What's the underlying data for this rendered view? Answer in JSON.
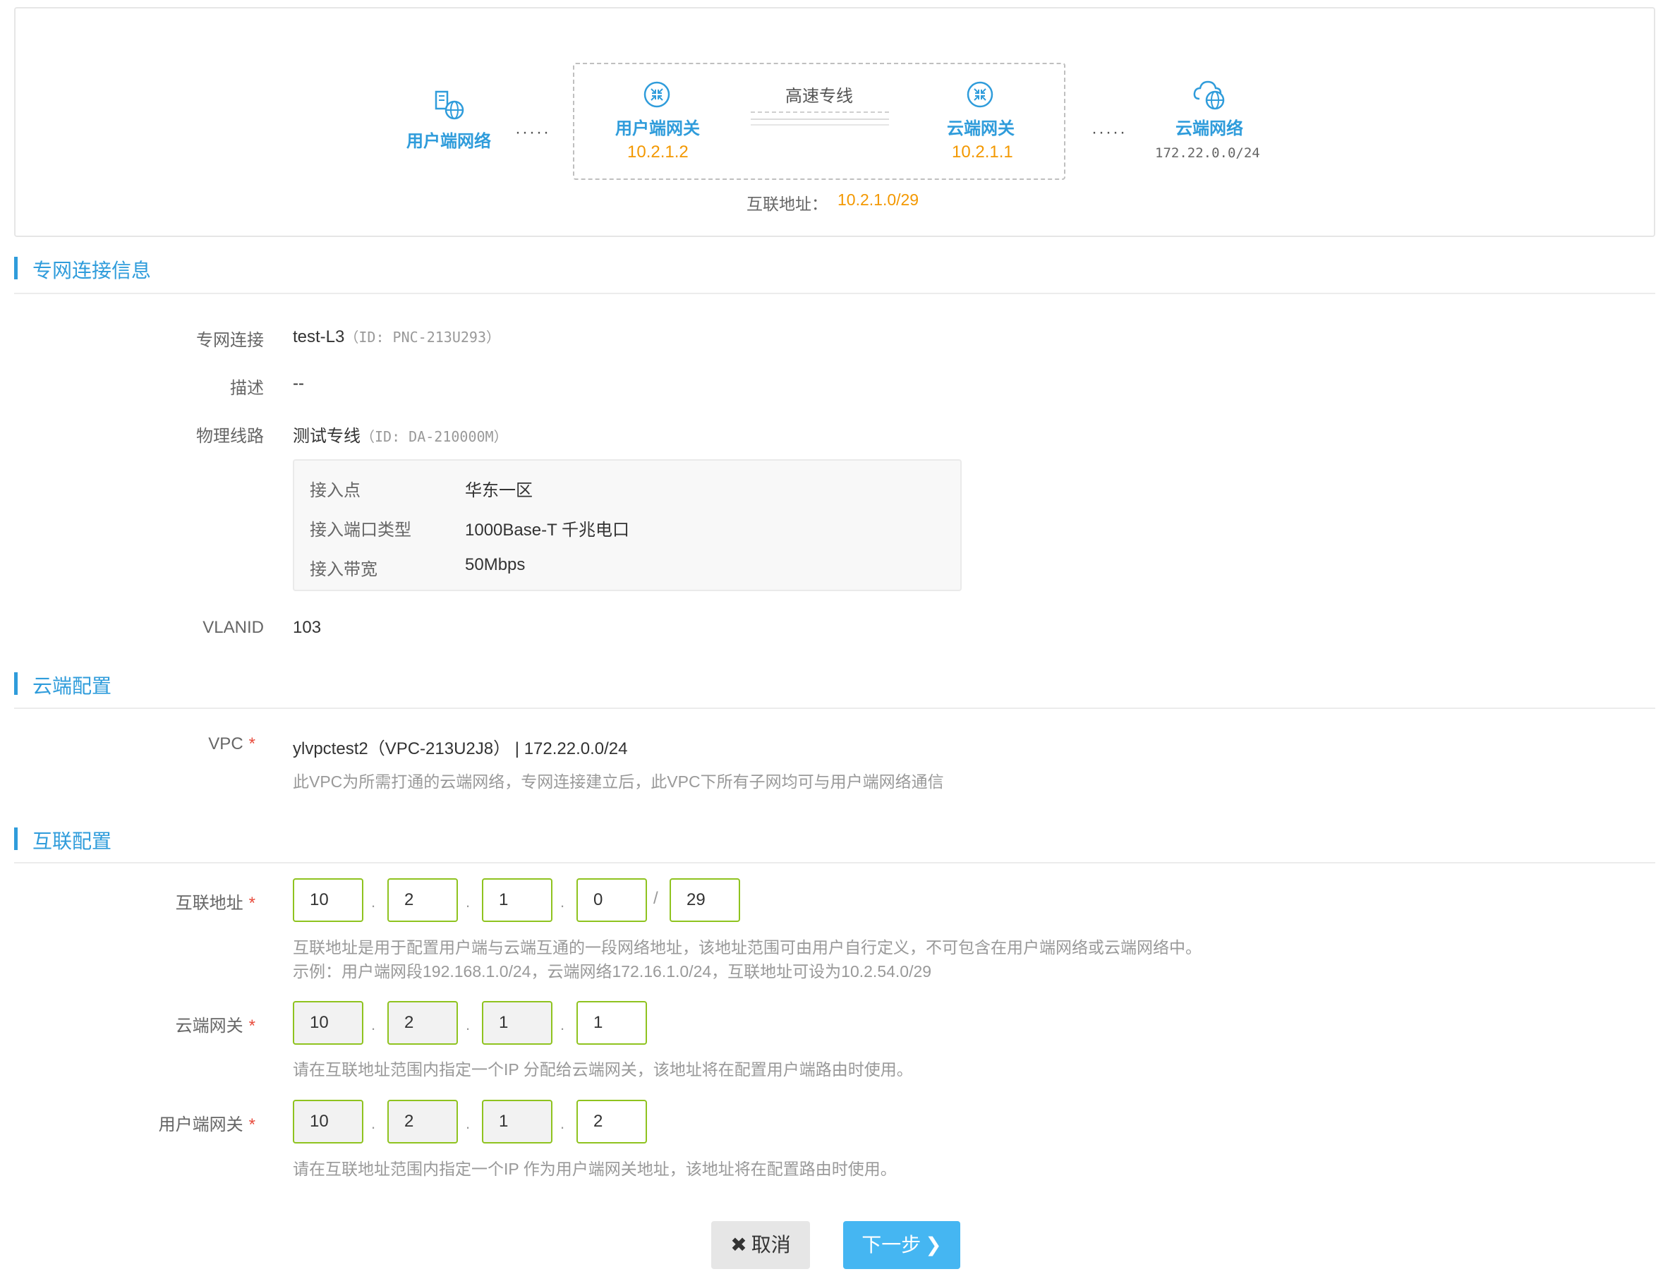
{
  "topology": {
    "user_network": {
      "label": "用户端网络"
    },
    "user_gateway": {
      "label": "用户端网关",
      "ip": "10.2.1.2"
    },
    "line_label": "高速专线",
    "cloud_gateway": {
      "label": "云端网关",
      "ip": "10.2.1.1"
    },
    "cloud_network": {
      "label": "云端网络",
      "cidr": "172.22.0.0/24"
    },
    "dots": "·····",
    "interconnect_label": "互联地址：",
    "interconnect_value": "10.2.1.0/29"
  },
  "sections": {
    "connection_info": "专网连接信息",
    "cloud_config": "云端配置",
    "interconnect_config": "互联配置"
  },
  "connection": {
    "label": "专网连接",
    "name": "test-L3",
    "id_text": "（ID: PNC-213U293）",
    "desc_label": "描述",
    "desc_value": "--",
    "line_label": "物理线路",
    "line_name": "测试专线",
    "line_id_text": "（ID: DA-210000M）",
    "details": [
      {
        "label": "接入点",
        "value": "华东一区"
      },
      {
        "label": "接入端口类型",
        "value": "1000Base-T 千兆电口"
      },
      {
        "label": "接入带宽",
        "value": "50Mbps"
      }
    ],
    "vlan_label": "VLANID",
    "vlan_value": "103"
  },
  "cloud": {
    "vpc_label": "VPC",
    "required": "*",
    "vpc_value": "ylvpctest2（VPC-213U2J8） | 172.22.0.0/24",
    "vpc_hint": "此VPC为所需打通的云端网络，专网连接建立后，此VPC下所有子网均可与用户端网络通信"
  },
  "interconnect": {
    "address_label": "互联地址",
    "address": [
      "10",
      "2",
      "1",
      "0"
    ],
    "mask": "29",
    "address_hint1": "互联地址是用于配置用户端与云端互通的一段网络地址，该地址范围可由用户自行定义，不可包含在用户端网络或云端网络中。",
    "address_hint2": "示例：用户端网段192.168.1.0/24，云端网络172.16.1.0/24，互联地址可设为10.2.54.0/29",
    "cloud_gw_label": "云端网关",
    "cloud_gw": [
      "10",
      "2",
      "1",
      "1"
    ],
    "cloud_gw_hint": "请在互联地址范围内指定一个IP 分配给云端网关，该地址将在配置用户端路由时使用。",
    "user_gw_label": "用户端网关",
    "user_gw": [
      "10",
      "2",
      "1",
      "2"
    ],
    "user_gw_hint": "请在互联地址范围内指定一个IP 作为用户端网关地址，该地址将在配置路由时使用。",
    "dot": ".",
    "slash": "/"
  },
  "buttons": {
    "cancel": "取消",
    "next": "下一步"
  },
  "colors": {
    "accent": "#2f9cdb",
    "ip": "#f39800",
    "input_border": "#8fc31f",
    "next_bg": "#45b6f2"
  }
}
